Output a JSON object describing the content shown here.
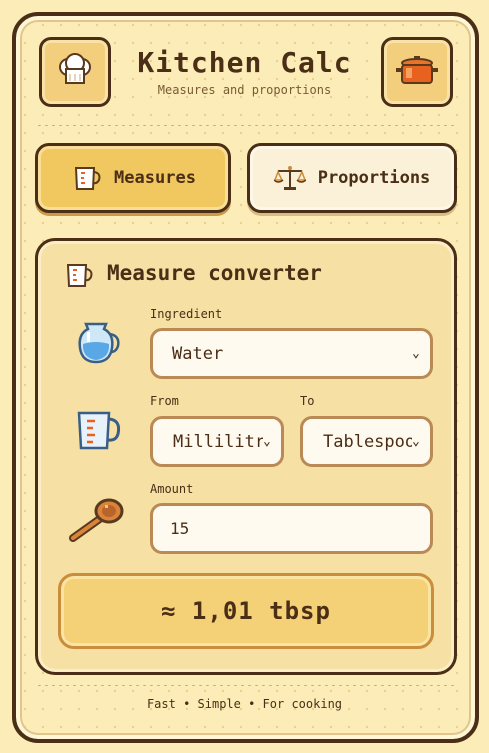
{
  "header": {
    "title": "Kitchen Calc",
    "subtitle": "Measures and proportions",
    "left_icon": "chef-hat-icon",
    "right_icon": "cooking-pot-icon"
  },
  "tabs": [
    {
      "label": "Measures",
      "icon": "measuring-cup-icon",
      "active": true
    },
    {
      "label": "Proportions",
      "icon": "scales-icon",
      "active": false
    }
  ],
  "converter": {
    "title": "Measure converter",
    "title_icon": "measuring-cup-icon",
    "ingredient_label": "Ingredient",
    "ingredient_value": "Water",
    "from_label": "From",
    "from_value": "Millilitres",
    "to_label": "To",
    "to_value": "Tablespoons",
    "amount_label": "Amount",
    "amount_value": "15",
    "result": "≈ 1,01 tbsp"
  },
  "footer": "Fast • Simple • For cooking",
  "colors": {
    "background": "#fbecb8",
    "outline": "#4a2e16",
    "active_tab": "#f1c860",
    "panel": "#f6e0a3",
    "field_border": "#b98a55"
  }
}
